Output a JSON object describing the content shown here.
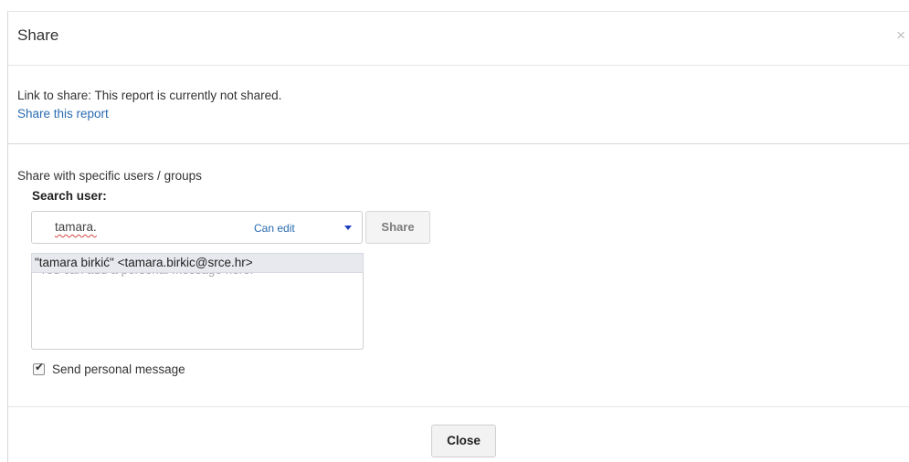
{
  "dialog": {
    "title": "Share",
    "close_icon_glyph": "×"
  },
  "link_section": {
    "status_text": "Link to share: This report is currently not shared.",
    "share_link_text": "Share this report"
  },
  "users_section": {
    "title": "Share with specific users / groups",
    "search_label": "Search user:",
    "search_value": "tamara.",
    "permission_label": "Can edit",
    "share_button_label": "Share",
    "suggestion": "\"tamara birkić\" <tamara.birkic@srce.hr>",
    "message_placeholder": "You can add a personal message here.",
    "send_message_label": "Send personal message",
    "send_message_checked": true
  },
  "footer": {
    "close_button_label": "Close"
  },
  "colors": {
    "link": "#2a6bb0",
    "caret": "#1d3fbf",
    "suggestion_bg": "#e7e9ee"
  }
}
